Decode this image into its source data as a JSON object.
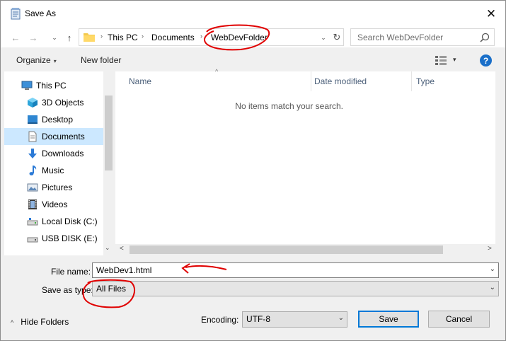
{
  "window": {
    "title": "Save As",
    "close_glyph": "✕"
  },
  "nav": {
    "back_glyph": "←",
    "forward_glyph": "→",
    "recent_glyph": "⌄",
    "up_glyph": "↑",
    "breadcrumb": [
      "This PC",
      "Documents",
      "WebDevFolder"
    ],
    "crumb_sep": "›",
    "dropdown_glyph": "⌄",
    "refresh_glyph": "↻",
    "search_placeholder": "Search WebDevFolder"
  },
  "toolbar": {
    "organize_label": "Organize",
    "organize_caret": "▾",
    "new_folder_label": "New folder",
    "view_caret": "▾",
    "help_glyph": "?"
  },
  "sidebar": {
    "items": [
      {
        "label": "This PC",
        "icon": "computer-icon"
      },
      {
        "label": "3D Objects",
        "icon": "cube-icon"
      },
      {
        "label": "Desktop",
        "icon": "desktop-icon"
      },
      {
        "label": "Documents",
        "icon": "document-icon",
        "selected": true
      },
      {
        "label": "Downloads",
        "icon": "download-icon"
      },
      {
        "label": "Music",
        "icon": "music-icon"
      },
      {
        "label": "Pictures",
        "icon": "picture-icon"
      },
      {
        "label": "Videos",
        "icon": "video-icon"
      },
      {
        "label": "Local Disk (C:)",
        "icon": "drive-icon"
      },
      {
        "label": "USB DISK (E:)",
        "icon": "usb-drive-icon"
      }
    ],
    "scroll_down_glyph": "⌄"
  },
  "filelist": {
    "columns": [
      "Name",
      "Date modified",
      "Type"
    ],
    "sort_glyph": "^",
    "empty_message": "No items match your search.",
    "scroll_left_glyph": "<",
    "scroll_right_glyph": ">"
  },
  "form": {
    "file_name_label": "File name:",
    "file_name_value": "WebDev1.html",
    "save_type_label": "Save as type:",
    "save_type_value": "All Files",
    "dropdown_glyph": "⌄"
  },
  "footer": {
    "hide_folders_label": "Hide Folders",
    "hide_caret": "^",
    "encoding_label": "Encoding:",
    "encoding_value": "UTF-8",
    "save_label": "Save",
    "cancel_label": "Cancel"
  },
  "colors": {
    "accent": "#0078d7",
    "selection": "#cce8ff",
    "annotation": "#e00000",
    "help_icon": "#1a6fc9"
  }
}
